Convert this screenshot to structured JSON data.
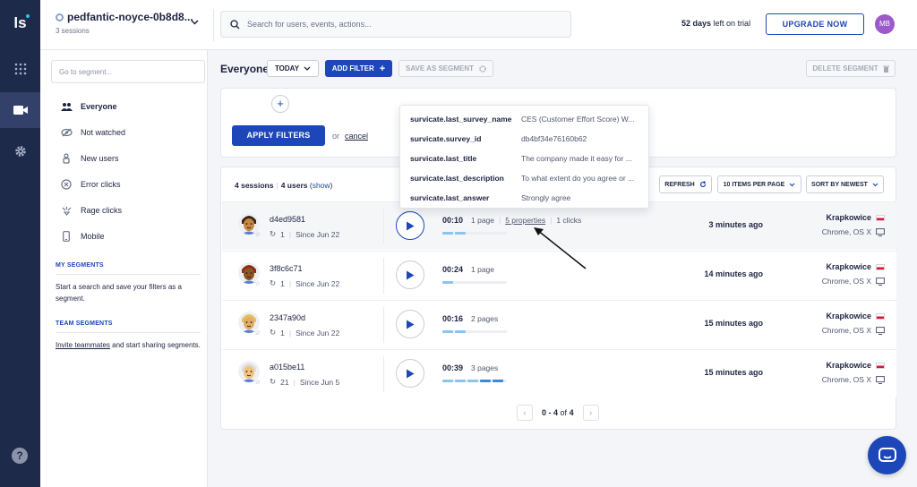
{
  "rail": {
    "logo": "ls",
    "icons": [
      "apps-grid-icon",
      "video-camera-icon",
      "gear-icon",
      "help-icon"
    ],
    "help_label": "?"
  },
  "header": {
    "project_name": "pedfantic-noyce-0b8d8...",
    "project_sessions": "3 sessions",
    "search_placeholder": "Search for users, events, actions...",
    "trial_days": "52 days",
    "trial_suffix": "left on trial",
    "upgrade_label": "UPGRADE NOW",
    "avatar_initials": "MB"
  },
  "sidebar": {
    "segment_placeholder": "Go to segment...",
    "items": [
      {
        "label": "Everyone",
        "icon": "people-icon",
        "active": true
      },
      {
        "label": "Not watched",
        "icon": "eye-off-icon",
        "active": false
      },
      {
        "label": "New users",
        "icon": "new-user-icon",
        "active": false
      },
      {
        "label": "Error clicks",
        "icon": "error-x-icon",
        "active": false
      },
      {
        "label": "Rage clicks",
        "icon": "rage-click-icon",
        "active": false
      },
      {
        "label": "Mobile",
        "icon": "mobile-icon",
        "active": false
      }
    ],
    "my_segments_title": "MY SEGMENTS",
    "my_segments_text": "Start a search and save your filters as a segment.",
    "team_segments_title": "TEAM SEGMENTS",
    "team_segments_link": "Invite teammates",
    "team_segments_text": "and start sharing segments."
  },
  "toolbar": {
    "segment_title": "Everyone",
    "today_label": "TODAY",
    "add_filter_label": "ADD FILTER",
    "save_segment_label": "SAVE AS SEGMENT",
    "delete_segment_label": "DELETE SEGMENT"
  },
  "filters": {
    "apply_label": "APPLY FILTERS",
    "or_text": "or",
    "cancel_label": "cancel"
  },
  "sessions": {
    "session_count": "4 sessions",
    "user_count": "4 users",
    "show_label": "show",
    "refresh_label": "REFRESH",
    "per_page_label": "10 ITEMS PER PAGE",
    "sort_label": "SORT BY NEWEST",
    "rows": [
      {
        "id": "d4ed9581",
        "visits": "1",
        "since": "Since Jun 22",
        "duration": "00:10",
        "pages": "1 page",
        "properties": "5 properties",
        "clicks": "1 clicks",
        "time_ago": "3 minutes ago",
        "location": "Krapkowice",
        "os": "Chrome, OS X",
        "progress_segments": 2,
        "avatar_skin": "#c68642",
        "avatar_hair": "#3b2314"
      },
      {
        "id": "3f8c6c71",
        "visits": "1",
        "since": "Since Jun 22",
        "duration": "00:24",
        "pages": "1 page",
        "properties": "",
        "clicks": "",
        "time_ago": "14 minutes ago",
        "location": "Krapkowice",
        "os": "Chrome, OS X",
        "progress_segments": 1,
        "avatar_skin": "#8d5524",
        "avatar_hair": "#8b2d14"
      },
      {
        "id": "2347a90d",
        "visits": "1",
        "since": "Since Jun 22",
        "duration": "00:16",
        "pages": "2 pages",
        "properties": "",
        "clicks": "",
        "time_ago": "15 minutes ago",
        "location": "Krapkowice",
        "os": "Chrome, OS X",
        "progress_segments": 2,
        "avatar_skin": "#e0ac69",
        "avatar_hair": "#e8c15a"
      },
      {
        "id": "a015be11",
        "visits": "21",
        "since": "Since Jun 5",
        "duration": "00:39",
        "pages": "3 pages",
        "properties": "",
        "clicks": "",
        "time_ago": "15 minutes ago",
        "location": "Krapkowice",
        "os": "Chrome, OS X",
        "progress_segments": 5,
        "avatar_skin": "#f1c27d",
        "avatar_hair": "#dcdcdc"
      }
    ],
    "pager_range": "0 - 4",
    "pager_of": "of",
    "pager_total": "4"
  },
  "popover": {
    "properties": [
      {
        "key": "survicate.last_survey_name",
        "value": "CES (Customer Effort Score) W..."
      },
      {
        "key": "survicate.survey_id",
        "value": "db4bf34e76160b62"
      },
      {
        "key": "survicate.last_title",
        "value": "The company made it easy for ..."
      },
      {
        "key": "survicate.last_description",
        "value": "To what extent do you agree or ..."
      },
      {
        "key": "survicate.last_answer",
        "value": "Strongly agree"
      }
    ]
  },
  "colors": {
    "accent": "#1d46b8",
    "rail": "#1e2a4a",
    "progress": "#8cc4ea",
    "progress_dark": "#3e86d6"
  }
}
